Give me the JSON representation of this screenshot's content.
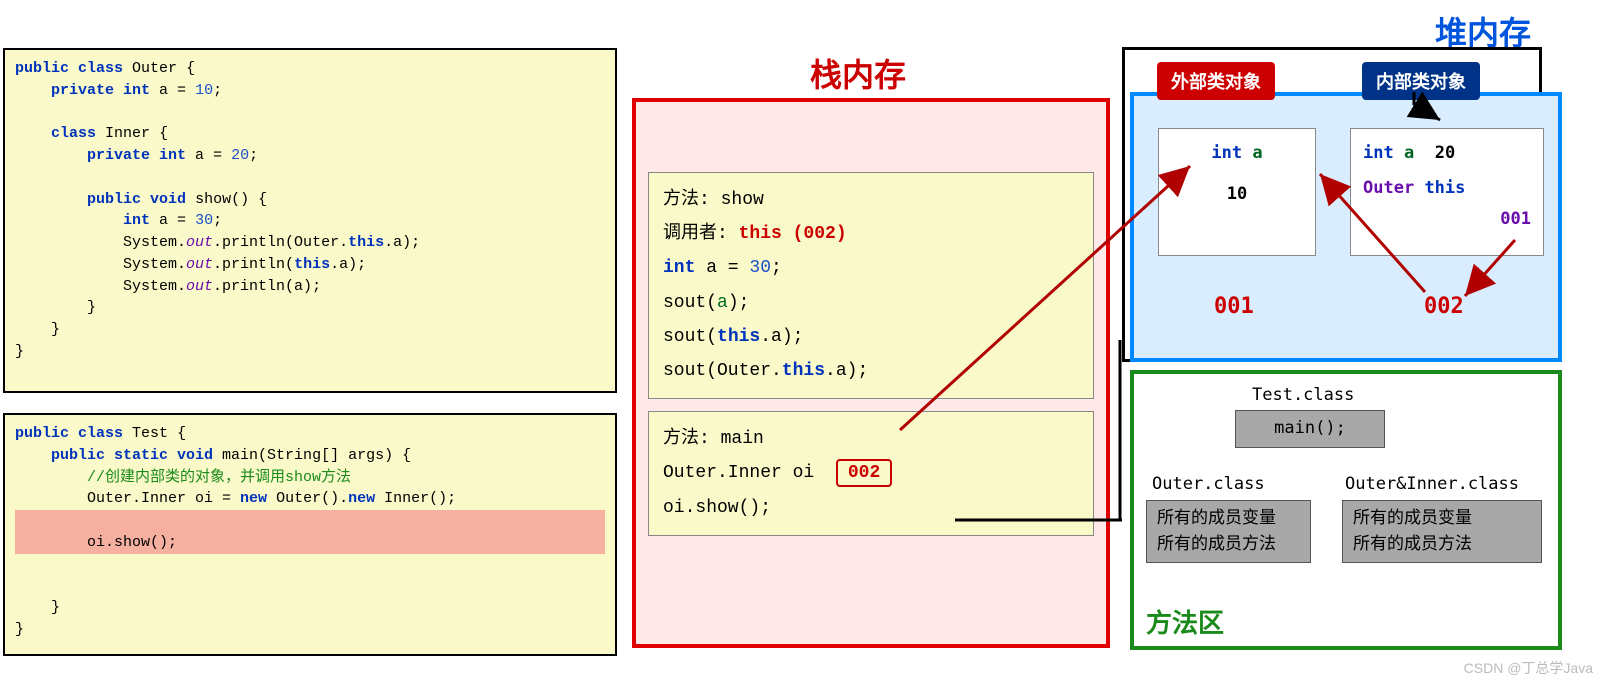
{
  "code": {
    "outer_class": "Outer",
    "outer_field_a": "10",
    "inner_class": "Inner",
    "inner_field_a": "20",
    "show_method": "show",
    "local_a": "30",
    "sout_outer": "Outer.this.a",
    "sout_this": "this.a",
    "sout_a": "a",
    "test_class": "Test",
    "main_sig": "main(String[] args)",
    "comment": "//创建内部类的对象，并调用show方法",
    "oi_decl": "Outer.Inner oi = new Outer().new Inner();",
    "oi_show": "oi.show();"
  },
  "titles": {
    "stack": "栈内存",
    "heap": "堆内存",
    "method_area": "方法区"
  },
  "stack": {
    "show_frame": {
      "method_label": "方法: show",
      "caller_label": "调用者: ",
      "caller_value": "this (002)",
      "local": "int a = 30;",
      "sout_a_pre": "sout(",
      "sout_a_arg": "a",
      "sout_a_post": ");",
      "sout_this_pre": "sout(",
      "sout_this_kw": "this",
      "sout_this_dot": ".a);",
      "sout_outer_pre": "sout(Outer.",
      "sout_outer_kw": "this",
      "sout_outer_dot": ".a);"
    },
    "main_frame": {
      "method_label": "方法: main",
      "oi_decl_type": "Outer.Inner  oi",
      "oi_value": "002",
      "oi_show": "oi.show();"
    }
  },
  "heap": {
    "outer_badge": "外部类对象",
    "inner_badge": "内部类对象",
    "outer_obj": {
      "field": "int a",
      "value": "10"
    },
    "inner_obj": {
      "field_a": "int a  20",
      "field_this": "Outer this",
      "this_value": "001"
    },
    "addr_outer": "001",
    "addr_inner": "002"
  },
  "method_area": {
    "test_class": "Test.class",
    "test_method": "main();",
    "outer_class": "Outer.class",
    "inner_class": "Outer&Inner.class",
    "members_vars": "所有的成员变量",
    "members_methods": "所有的成员方法"
  },
  "watermark": "CSDN @丁总学Java"
}
